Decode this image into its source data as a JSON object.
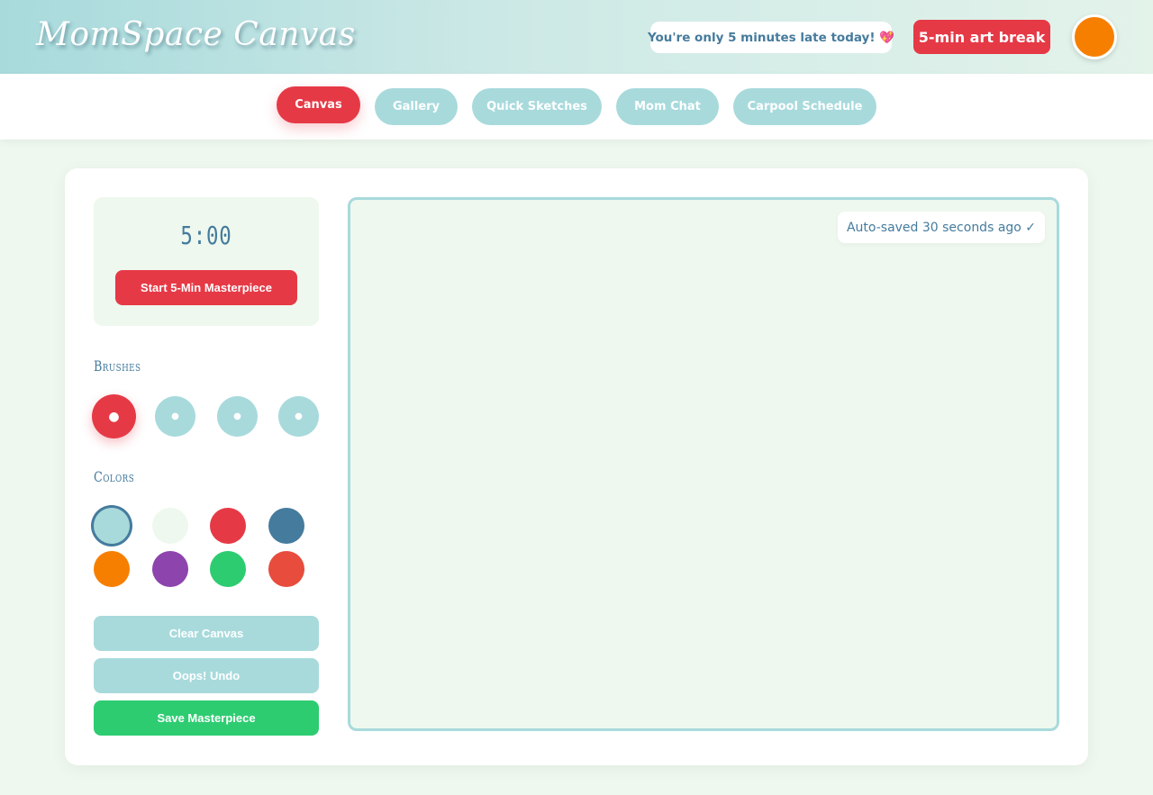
{
  "header": {
    "logo": "MomSpace Canvas",
    "late_message": "You're only 5 minutes late today! 💖",
    "break_button": "5-min art break"
  },
  "nav": {
    "tabs": [
      {
        "label": "Canvas",
        "active": true
      },
      {
        "label": "Gallery",
        "active": false
      },
      {
        "label": "Quick Sketches",
        "active": false
      },
      {
        "label": "Mom Chat",
        "active": false
      },
      {
        "label": "Carpool Schedule",
        "active": false
      }
    ]
  },
  "timer": {
    "display": "5:00",
    "start_button": "Start 5-Min Masterpiece"
  },
  "brushes": {
    "title": "Brushes",
    "items": [
      {
        "symbol": "●",
        "active": true
      },
      {
        "symbol": "●",
        "active": false
      },
      {
        "symbol": "●",
        "active": false
      },
      {
        "symbol": "●",
        "active": false
      }
    ]
  },
  "colors": {
    "title": "Colors",
    "swatches": [
      "#a8dadc",
      "#eef8ee",
      "#e63946",
      "#457b9d",
      "#f77f00",
      "#8e44ad",
      "#2ecc71",
      "#e74c3c"
    ],
    "selected_index": 0
  },
  "actions": {
    "clear": "Clear Canvas",
    "undo": "Oops! Undo",
    "save": "Save Masterpiece"
  },
  "canvas": {
    "autosave_status": "Auto-saved 30 seconds ago ✓"
  },
  "theme": {
    "accent": "#e63946",
    "secondary": "#a8dadc",
    "text": "#457b9d",
    "success": "#2ecc71",
    "avatar": "#f77f00"
  }
}
